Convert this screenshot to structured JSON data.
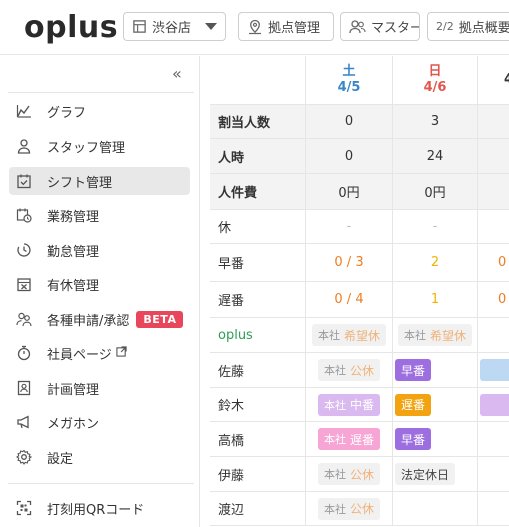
{
  "header": {
    "logo": "oplus",
    "store": "渋谷店",
    "kyoten": "拠点管理",
    "master": "マスター",
    "overview_frac": "2/2",
    "overview": "拠点概要"
  },
  "sidebar": {
    "items": [
      {
        "label": "グラフ",
        "icon": "chart-icon"
      },
      {
        "label": "スタッフ管理",
        "icon": "person-icon"
      },
      {
        "label": "シフト管理",
        "icon": "calendar-check-icon"
      },
      {
        "label": "業務管理",
        "icon": "calendar-clock-icon"
      },
      {
        "label": "勤怠管理",
        "icon": "clock-icon"
      },
      {
        "label": "有休管理",
        "icon": "calendar-x-icon"
      },
      {
        "label": "各種申請/承認",
        "icon": "people-icon",
        "badge": "BETA"
      },
      {
        "label": "社員ページ",
        "icon": "stopwatch-icon"
      },
      {
        "label": "計画管理",
        "icon": "id-card-icon"
      },
      {
        "label": "メガホン",
        "icon": "megaphone-icon"
      },
      {
        "label": "設定",
        "icon": "gear-icon"
      }
    ],
    "qr_label": "打刻用QRコード"
  },
  "days": [
    {
      "dow": "土",
      "date": "4/5",
      "type": "sat"
    },
    {
      "dow": "日",
      "date": "4/6",
      "type": "sun"
    },
    {
      "dow": "",
      "date": "4",
      "type": "cut"
    }
  ],
  "summary": {
    "headcount_label": "割当人数",
    "headcount": [
      "0",
      "3",
      ""
    ],
    "manhours_label": "人時",
    "manhours": [
      "0",
      "24",
      ""
    ],
    "cost_label": "人件費",
    "cost": [
      "0円",
      "0円",
      ""
    ]
  },
  "shift_rows": {
    "off": {
      "label": "休",
      "values": [
        "-",
        "-"
      ]
    },
    "early": {
      "label": "早番",
      "values": [
        "0 / 3",
        "2",
        "0"
      ]
    },
    "late": {
      "label": "遅番",
      "values": [
        "0 / 4",
        "1",
        "0"
      ]
    }
  },
  "group": {
    "label": "oplus",
    "cells": [
      {
        "prefix": "本社",
        "text": "希望休"
      },
      {
        "prefix": "本社",
        "text": "希望休"
      }
    ]
  },
  "staff": [
    {
      "name": "佐藤",
      "cells": [
        {
          "prefix": "本社",
          "text": "公休"
        },
        {
          "text": "早番"
        }
      ]
    },
    {
      "name": "鈴木",
      "cells": [
        {
          "prefix": "本社",
          "text": "中番"
        },
        {
          "text": "遅番"
        }
      ]
    },
    {
      "name": "高橋",
      "cells": [
        {
          "prefix": "本社",
          "text": "遅番"
        },
        {
          "text": "早番"
        }
      ]
    },
    {
      "name": "伊藤",
      "cells": [
        {
          "prefix": "本社",
          "text": "公休"
        },
        {
          "text": "法定休日"
        }
      ]
    },
    {
      "name": "渡辺",
      "cells": [
        {
          "prefix": "本社",
          "text": "公休"
        }
      ]
    }
  ],
  "colors": {
    "accent_green": "#2f9d55",
    "saturday": "#3a86c8",
    "sunday": "#e2564b",
    "beta": "#e8465b",
    "early_shift": "#9c6ee0",
    "late_shift": "#f2a30f",
    "mid_shift": "#d9b9f0",
    "late_shift_hq": "#f7a5d5"
  }
}
